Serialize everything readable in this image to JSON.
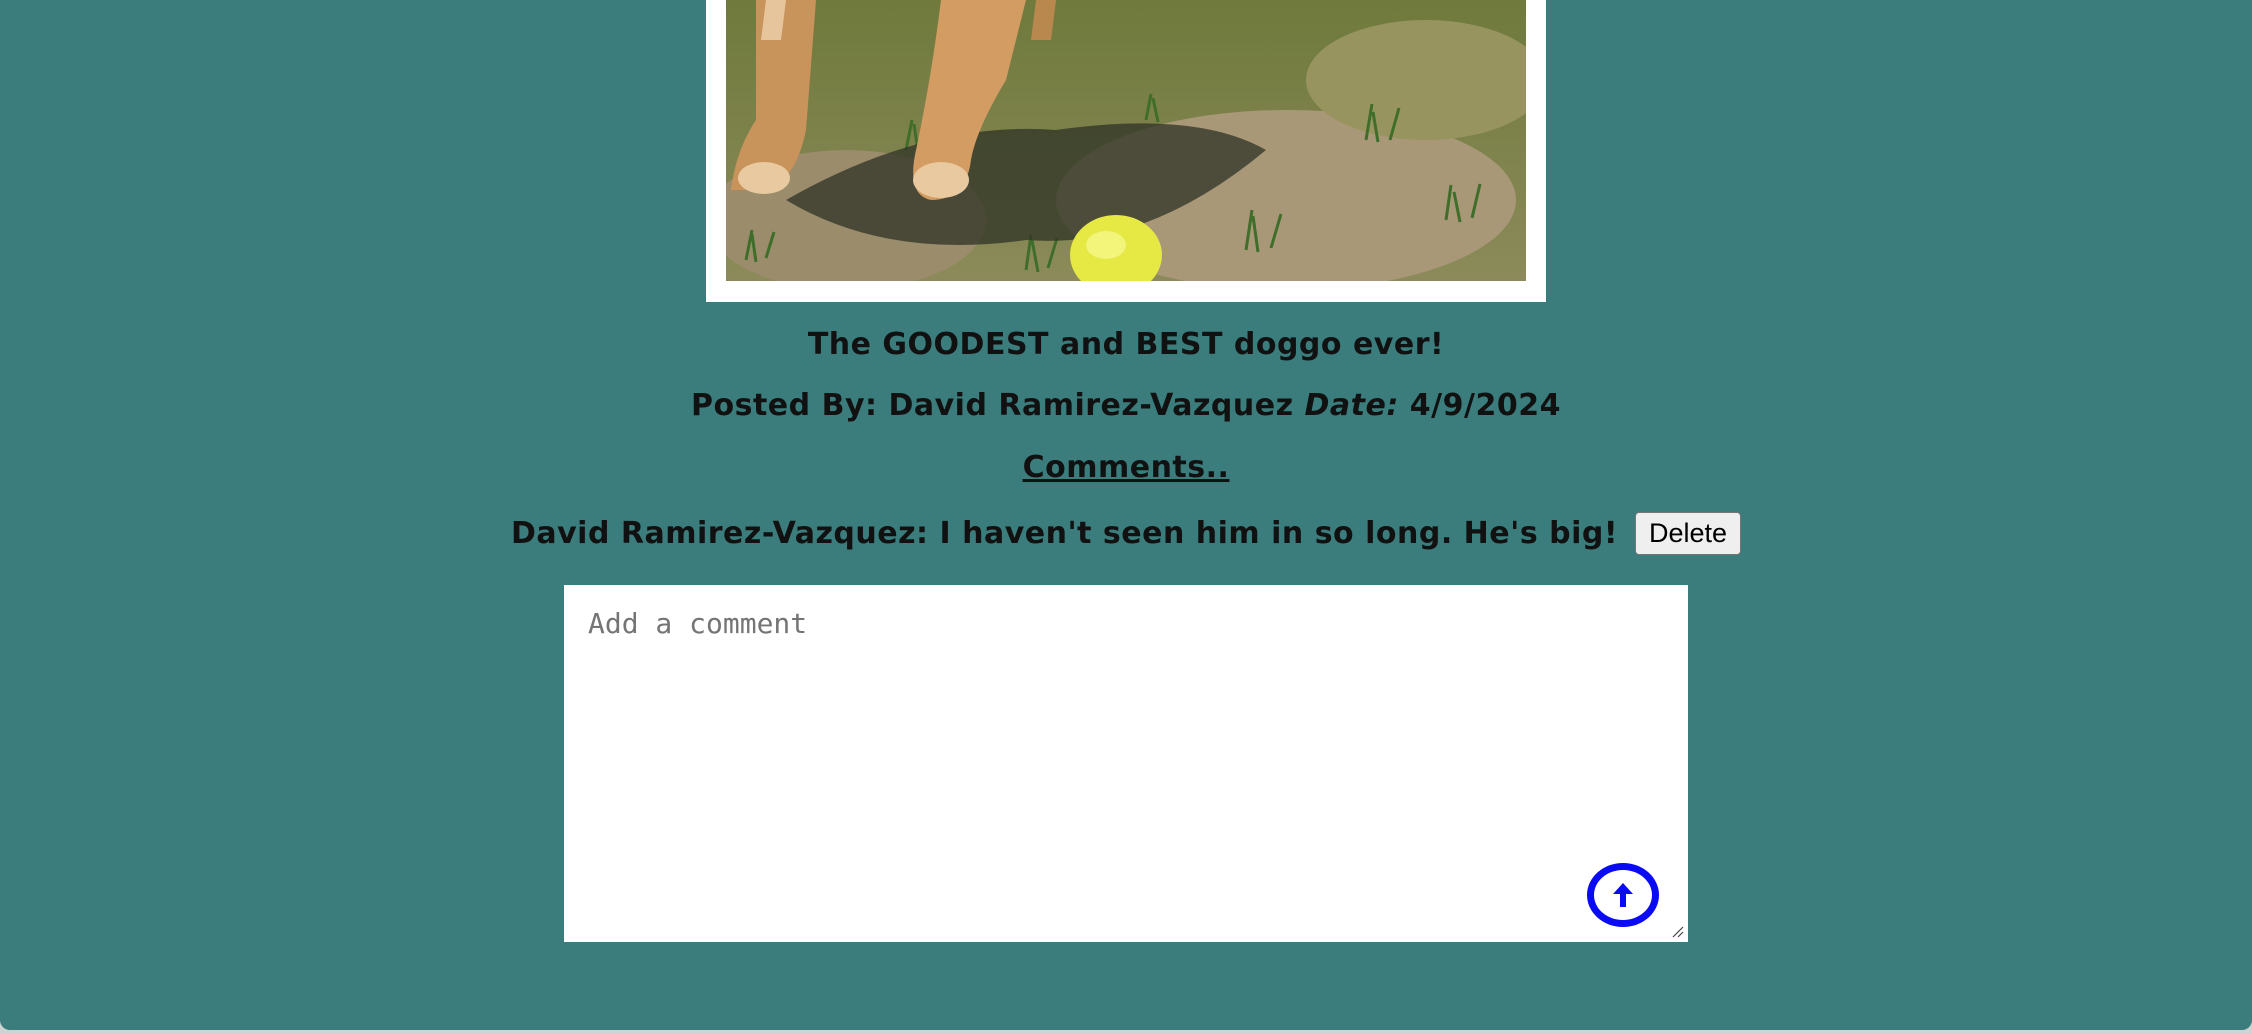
{
  "post": {
    "image_alt": "dog-photo",
    "caption": "The GOODEST and BEST doggo ever!",
    "posted_by_label": "Posted By:",
    "author": "David Ramirez-Vazquez",
    "date_label": "Date:",
    "date": "4/9/2024"
  },
  "comments": {
    "heading": "Comments..",
    "items": [
      {
        "text": "David Ramirez-Vazquez: I haven't seen him in so long. He's big!",
        "delete_label": "Delete"
      }
    ]
  },
  "comment_form": {
    "placeholder": "Add a comment",
    "value": "",
    "submit_icon": "arrow-up-circle-icon",
    "submit_color": "#0a0af5"
  },
  "colors": {
    "background": "#3a7d7c",
    "frame": "#ffffff"
  }
}
